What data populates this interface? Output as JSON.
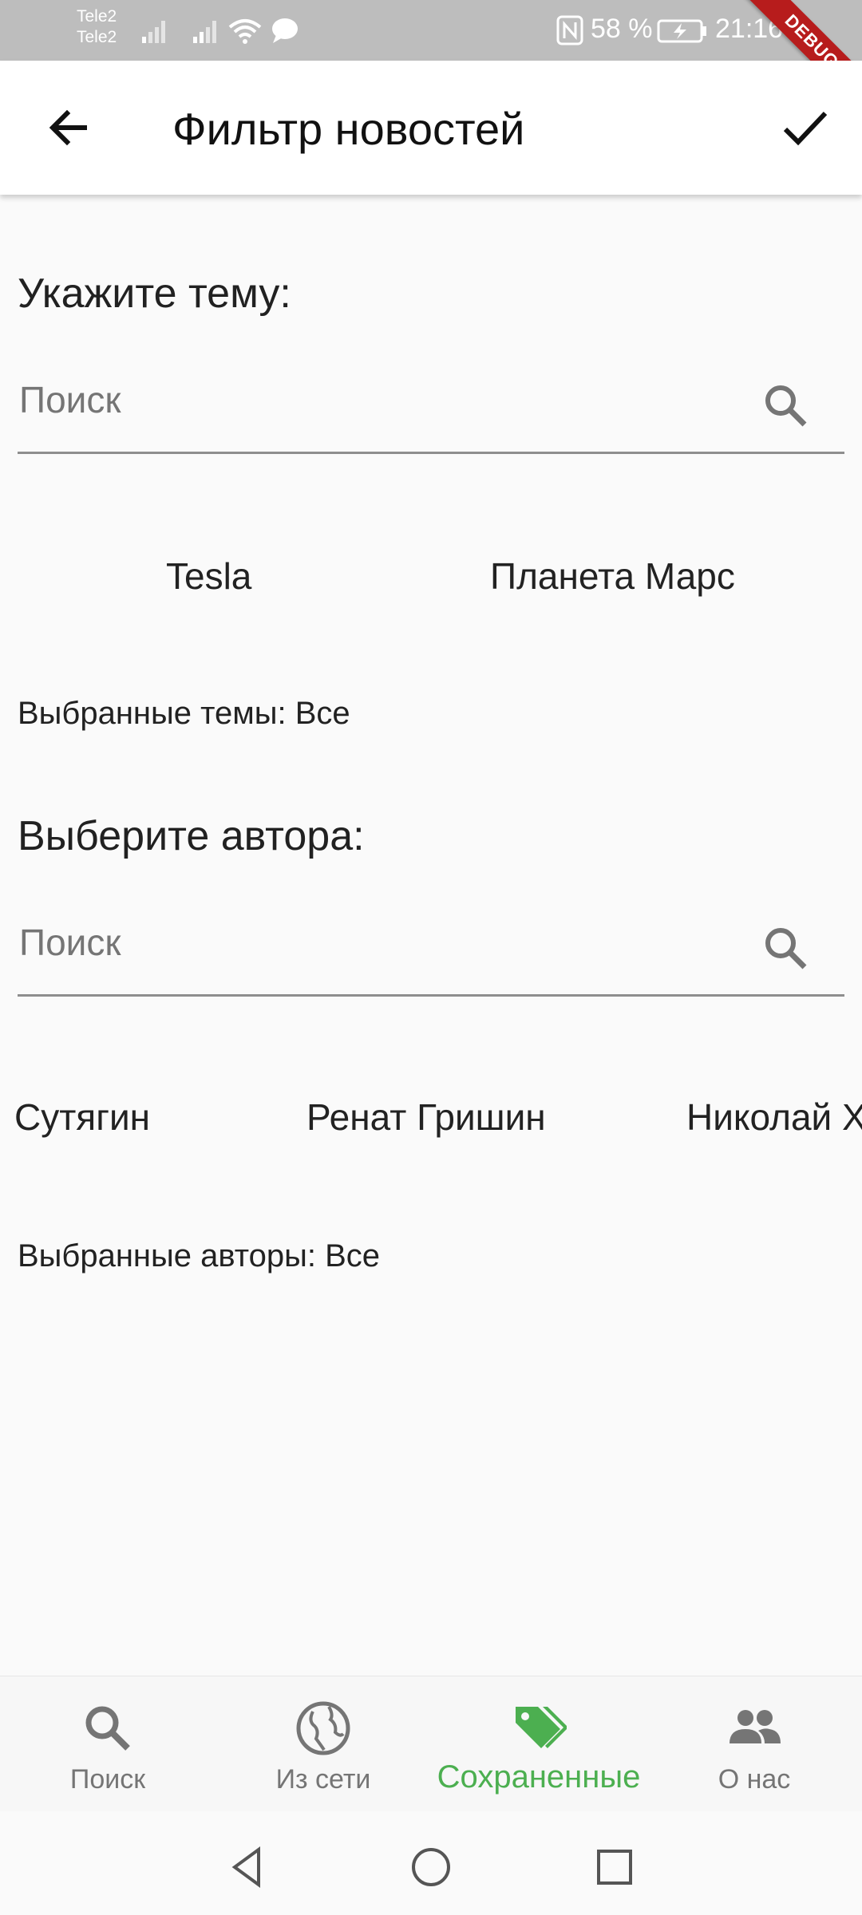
{
  "status_bar": {
    "carrier1": "Tele2",
    "carrier2": "Tele2",
    "battery_percent": "58 %",
    "time": "21:16",
    "debug_label": "DEBUG"
  },
  "app_bar": {
    "title": "Фильтр новостей"
  },
  "topics": {
    "heading": "Укажите тему:",
    "search_placeholder": "Поиск",
    "chips": [
      "Tesla",
      "Планета Марс"
    ],
    "selected_text": "Выбранные темы: Все"
  },
  "authors": {
    "heading": "Выберите автора:",
    "search_placeholder": "Поиск",
    "chips": [
      "Сутягин",
      "Ренат Гришин",
      "Николай Х"
    ],
    "selected_text": "Выбранные авторы: Все"
  },
  "bottom_nav": {
    "items": [
      {
        "label": "Поиск",
        "icon": "search-icon"
      },
      {
        "label": "Из сети",
        "icon": "globe-icon"
      },
      {
        "label": "Сохраненные",
        "icon": "tags-icon"
      },
      {
        "label": "О нас",
        "icon": "people-icon"
      }
    ],
    "active_index": 2
  },
  "colors": {
    "accent": "#4caf50",
    "status_bar": "#bdbdbd",
    "background": "#fafafa",
    "debug_ribbon": "#b71c1c"
  }
}
